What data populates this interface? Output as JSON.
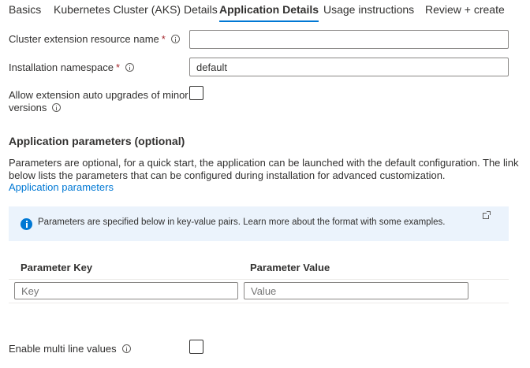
{
  "tabs": [
    {
      "label": "Basics"
    },
    {
      "label": "Kubernetes Cluster (AKS) Details"
    },
    {
      "label": "Application Details"
    },
    {
      "label": "Usage instructions"
    },
    {
      "label": "Review + create"
    }
  ],
  "form": {
    "ext_name_label": "Cluster extension resource name",
    "ext_name_value": "",
    "namespace_label": "Installation namespace",
    "namespace_value": "default",
    "auto_upgrade_label_line1": "Allow extension auto upgrades of minor",
    "auto_upgrade_label_line2": "versions",
    "auto_upgrade_checked": false,
    "required_marker": "*"
  },
  "app_params": {
    "title": "Application parameters (optional)",
    "description": "Parameters are optional, for a quick start, the application can be launched with the default configuration. The link below lists the parameters that can be configured during installation for advanced customization.",
    "link": "Application parameters"
  },
  "banner": {
    "text": "Parameters are specified below in key-value pairs. Learn more about the format with some examples."
  },
  "grid": {
    "key_header": "Parameter Key",
    "value_header": "Parameter Value",
    "key_placeholder": "Key",
    "value_placeholder": "Value"
  },
  "multiline": {
    "label": "Enable multi line values",
    "checked": false
  },
  "colors": {
    "accent": "#0078d4",
    "required": "#a4262c",
    "banner_bg": "#ebf3fc"
  },
  "icons": [
    "info-icon",
    "external-link-icon"
  ]
}
